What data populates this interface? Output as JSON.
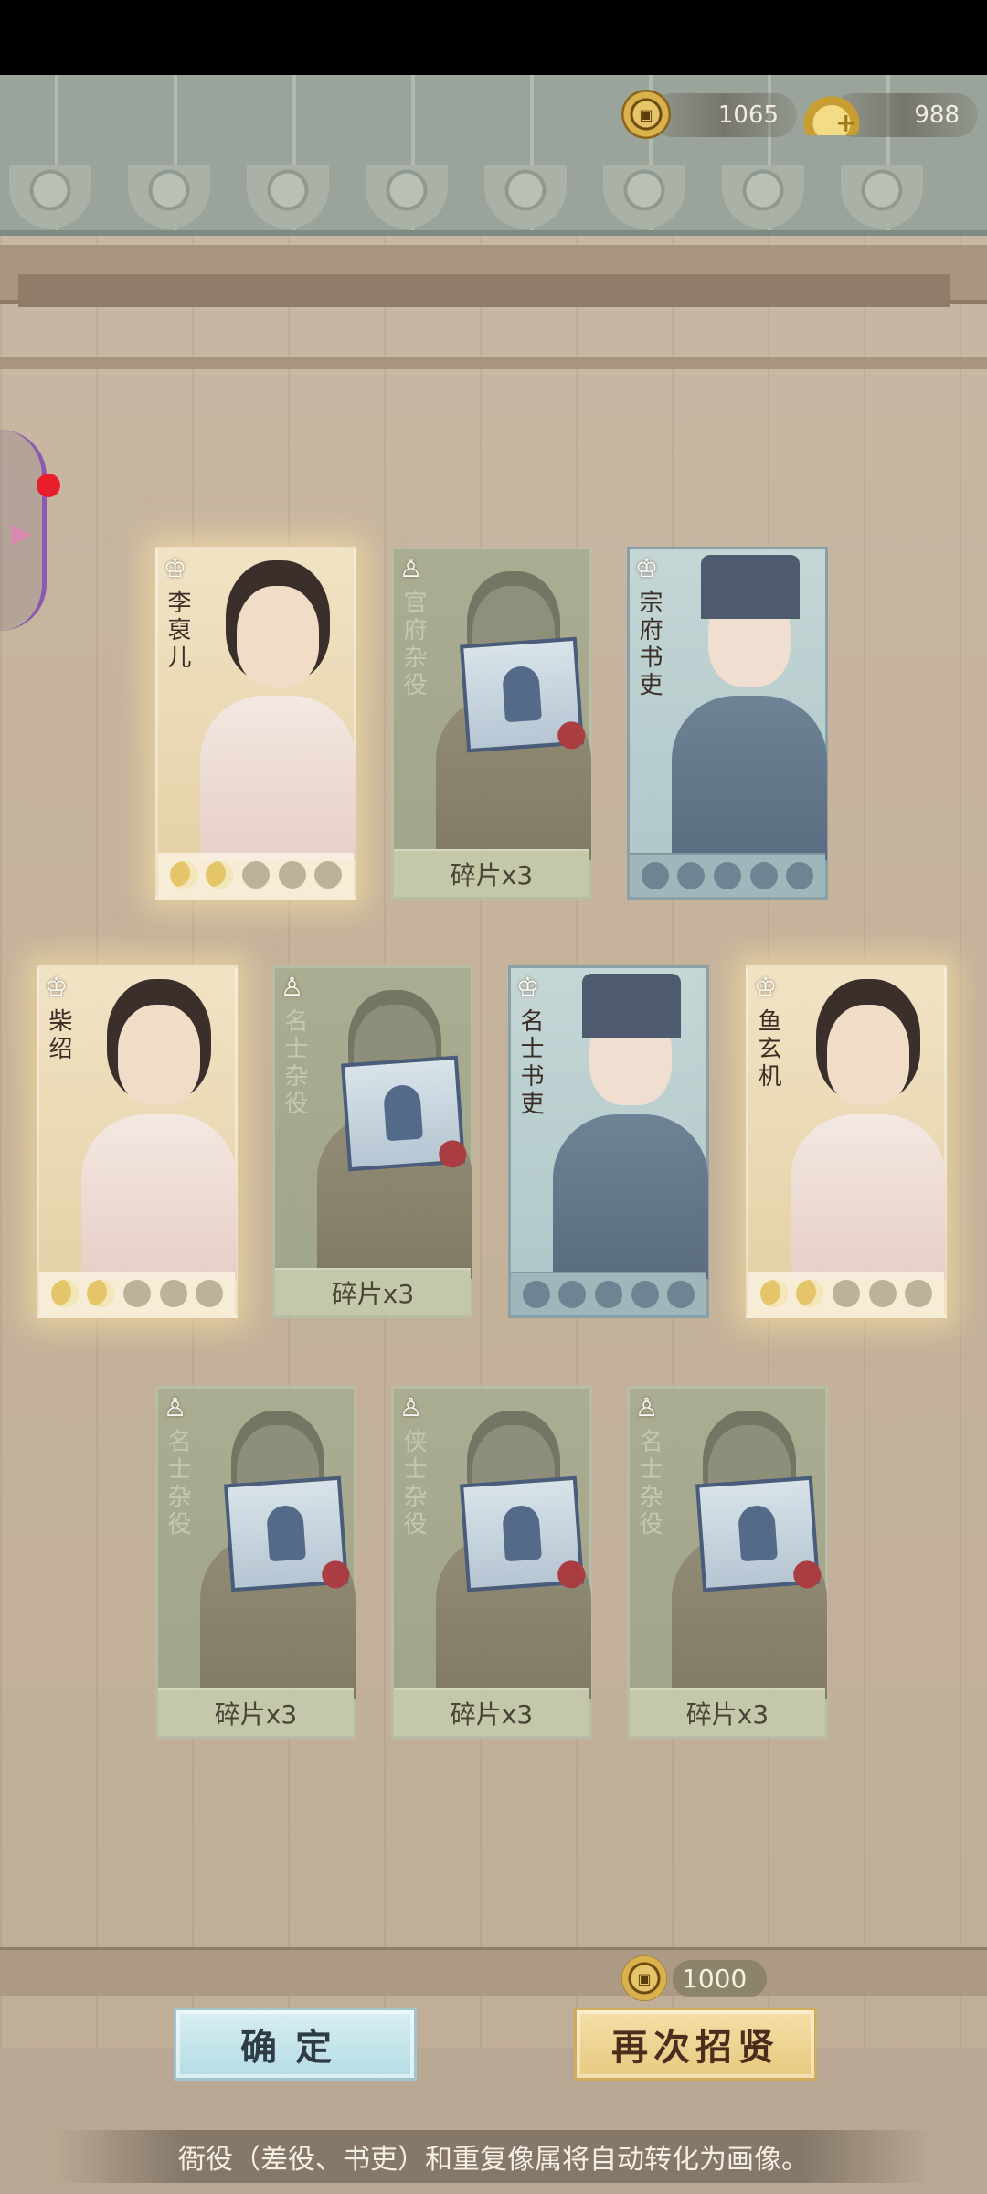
{
  "currency": {
    "coins": "1065",
    "ingots": "988",
    "coin_icon": "copper-coin-icon",
    "ingot_icon": "gold-ingot-icon"
  },
  "cards": [
    {
      "name": "李裒儿",
      "tier": "gold",
      "stars_filled": 2,
      "stars_total": 5
    },
    {
      "name": "官府杂役",
      "tier": "green",
      "fragments": "碎片x3"
    },
    {
      "name": "宗府书吏",
      "tier": "blue",
      "stars_filled": 0,
      "stars_total": 5
    },
    {
      "name": "柴绍",
      "tier": "gold",
      "stars_filled": 2,
      "stars_total": 5
    },
    {
      "name": "名士杂役",
      "tier": "green",
      "fragments": "碎片x3"
    },
    {
      "name": "名士书吏",
      "tier": "blue",
      "stars_filled": 0,
      "stars_total": 5
    },
    {
      "name": "鱼玄机",
      "tier": "gold",
      "stars_filled": 2,
      "stars_total": 5
    },
    {
      "name": "名士杂役",
      "tier": "green",
      "fragments": "碎片x3"
    },
    {
      "name": "侠士杂役",
      "tier": "green",
      "fragments": "碎片x3"
    },
    {
      "name": "名士杂役",
      "tier": "green",
      "fragments": "碎片x3"
    }
  ],
  "cost": {
    "amount": "1000"
  },
  "buttons": {
    "confirm": "确定",
    "recruit_again": "再次招贤"
  },
  "tip": "衙役（差役、书吏）和重复像属将自动转化为画像。",
  "colors": {
    "gold_card": "#f0e3c4",
    "blue_card": "#c5d6d6",
    "green_card": "#a9ad92",
    "confirm_btn": "#d8eef2",
    "recruit_btn": "#f4e0a8"
  }
}
